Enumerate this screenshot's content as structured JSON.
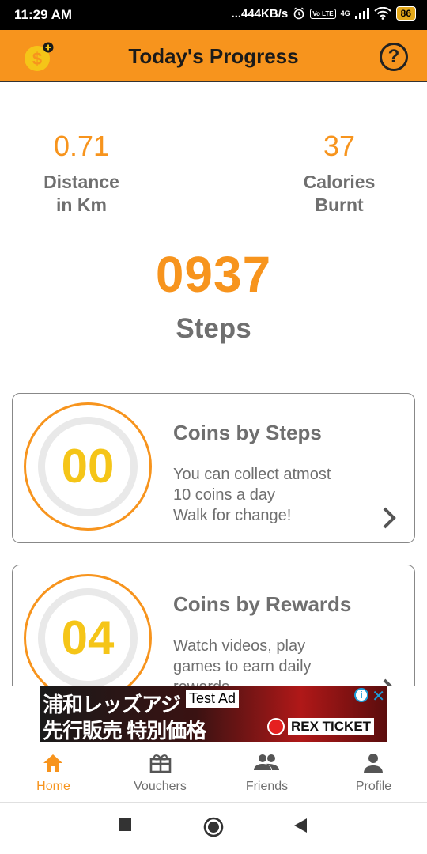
{
  "status_bar": {
    "time": "11:29 AM",
    "network_speed": "...444KB/s",
    "volte": "Vo LTE",
    "signal_type": "4G",
    "battery": "86"
  },
  "app_bar": {
    "title": "Today's Progress",
    "help": "?"
  },
  "stats": {
    "distance_value": "0.71",
    "distance_label_line1": "Distance",
    "distance_label_line2": "in Km",
    "calories_value": "37",
    "calories_label_line1": "Calories",
    "calories_label_line2": "Burnt"
  },
  "steps": {
    "value": "0937",
    "label": "Steps"
  },
  "cards": [
    {
      "coins": "00",
      "title": "Coins by Steps",
      "desc_line1": "You can collect atmost",
      "desc_line2": "10 coins a day",
      "desc_line3": "Walk for change!"
    },
    {
      "coins": "04",
      "title": "Coins by Rewards",
      "desc_line1": "Watch videos, play",
      "desc_line2": "games to earn daily",
      "desc_line3": "rewards"
    }
  ],
  "ad": {
    "line1": "浦和レッズアジ",
    "line2": "先行販売 特別価格",
    "label": "Test Ad",
    "ticket_text": "REX TICKET"
  },
  "bottom_nav": [
    {
      "label": "Home",
      "icon": "home-icon",
      "active": true
    },
    {
      "label": "Vouchers",
      "icon": "gift-icon",
      "active": false
    },
    {
      "label": "Friends",
      "icon": "people-icon",
      "active": false
    },
    {
      "label": "Profile",
      "icon": "person-icon",
      "active": false
    }
  ],
  "colors": {
    "accent": "#f7941d",
    "coin_text": "#f5c518",
    "text_gray": "#6f6f6f"
  }
}
